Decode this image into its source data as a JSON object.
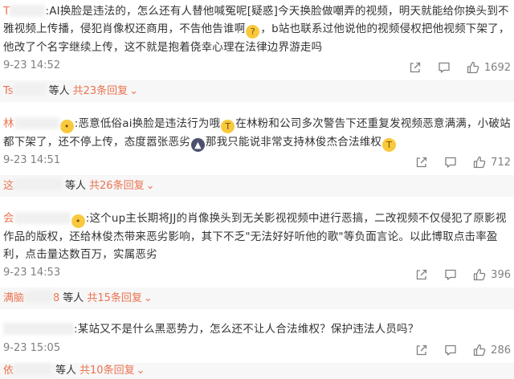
{
  "comments": [
    {
      "user": "T",
      "text": ":AI换脸是违法的，怎么还有人替他喊冤呢[疑惑]今天换脸做嘲弄的视频，明天就能给你换头到不雅视频上传播，侵犯肖像权还商用，不告他告谁啊",
      "text2": "，b站也联系过他说他的视频侵权把他视频下架了，他改了个名字继续上传，这不就是抱着侥幸心理在法律边界游走吗",
      "time": "9-23 14:52",
      "likes": "1692",
      "replies": {
        "user": "Ts",
        "people": "等人",
        "count": "共23条回复"
      }
    },
    {
      "user": "林",
      "text": ":恶意低俗ai换脸是违法行为哦",
      "text2": "在林粉和公司多次警告下还重复发视频恶意满满，小破站都下架了，还不停上传，态度嚣张恶劣",
      "text3": "那我只能说非常支持林俊杰合法维权",
      "time": "9-23 14:51",
      "likes": "712",
      "replies": {
        "user": "这",
        "people": "等人",
        "count": "共26条回复"
      }
    },
    {
      "user": "会",
      "text": ":这个up主长期将JJ的肖像换头到无关影视视频中进行恶搞，二改视频不仅侵犯了原影视作品的版权，还给林俊杰带来恶劣影响，其下不乏\"无法好好听他的歌\"等负面言论。以此博取点击率盈利，点击量达数百万，实属恶劣",
      "time": "9-23 14:53",
      "likes": "396",
      "replies": {
        "user": "满脑",
        "user_suffix": "8",
        "people": "等人",
        "count": "共15条回复"
      }
    },
    {
      "user": "",
      "text": ":某站又不是什么黑恶势力，怎么还不让人合法维权？保护违法人员吗？",
      "time": "9-23 15:05",
      "likes": "286",
      "replies": {
        "user": "依",
        "people": "等人",
        "count": "共10条回复"
      }
    }
  ],
  "icons": [
    "share-icon",
    "comment-icon",
    "like-icon",
    "chevron-down-icon"
  ],
  "colors": {
    "accent": "#eb7350",
    "meta": "#808080",
    "reply_bg": "#f7f7f7"
  }
}
